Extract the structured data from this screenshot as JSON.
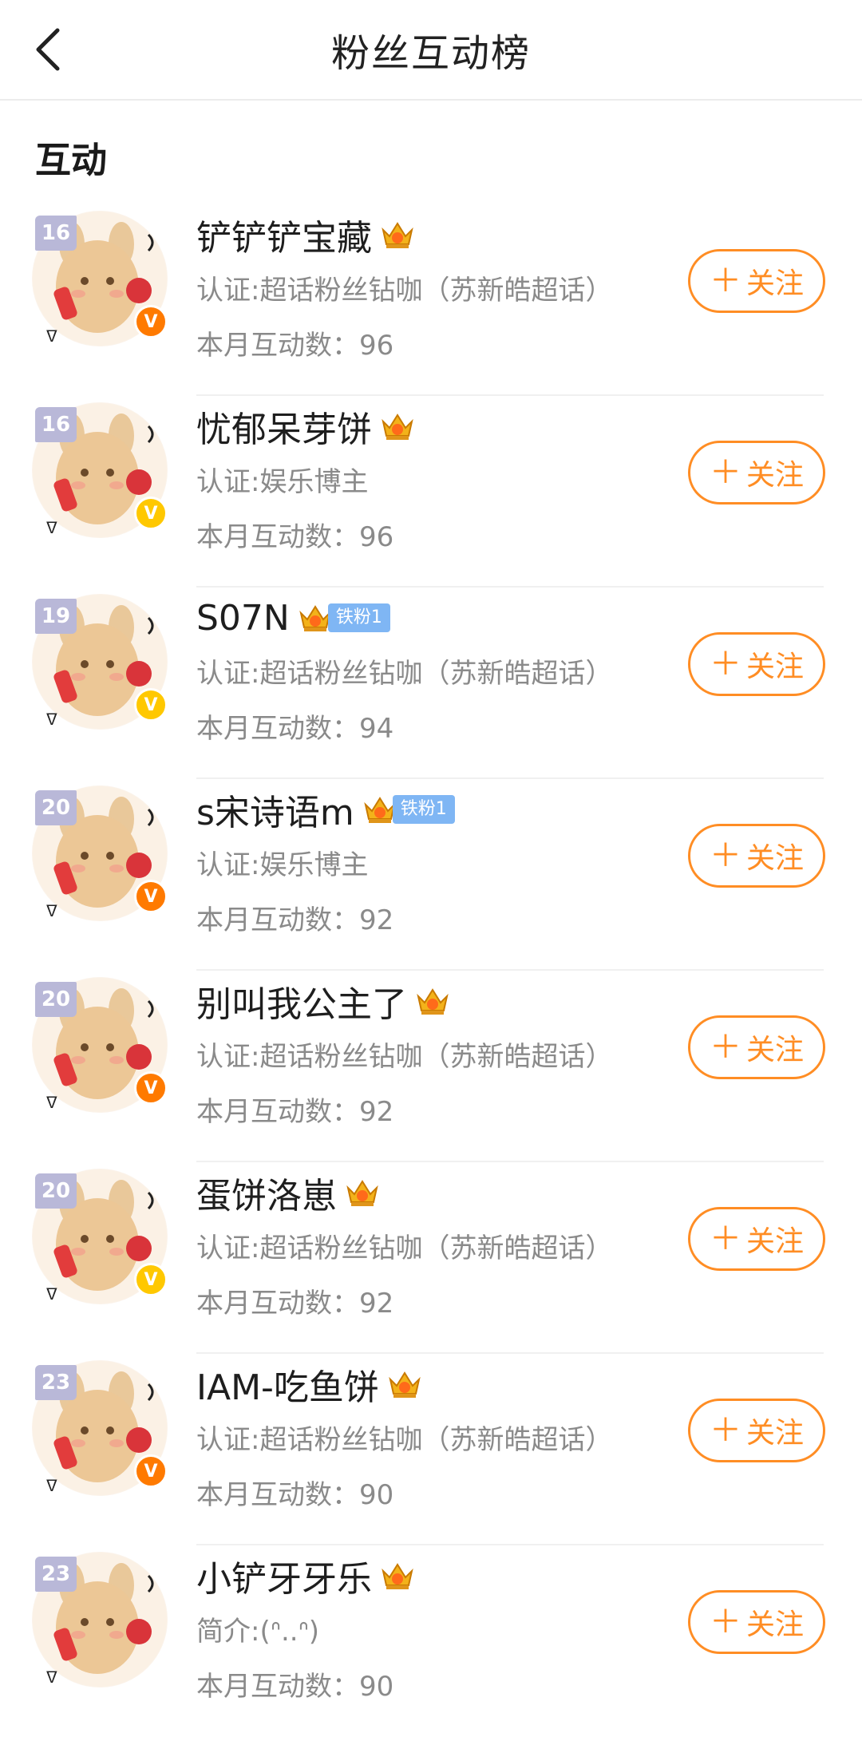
{
  "header": {
    "title": "粉丝互动榜",
    "back_icon": "chevron-left-icon"
  },
  "section": {
    "title": "互动"
  },
  "colors": {
    "accent": "#ff8d24",
    "verified_orange": "#ff7a00",
    "verified_yellow": "#ffc800",
    "tag_blue": "#7fb6f4",
    "rank_badge": "#b9b8d8"
  },
  "users": [
    {
      "rank_level": "16",
      "name": "铲铲铲宝藏",
      "tag": "",
      "verified": "orange",
      "desc": "认证:超话粉丝钻咖（苏新皓超话）",
      "count": "本月互动数：96",
      "follow_label": "关注"
    },
    {
      "rank_level": "16",
      "name": "忧郁呆芽饼",
      "tag": "",
      "verified": "yellow",
      "desc": "认证:娱乐博主",
      "count": "本月互动数：96",
      "follow_label": "关注"
    },
    {
      "rank_level": "19",
      "name": "S07N",
      "tag": "铁粉1",
      "verified": "yellow",
      "desc": "认证:超话粉丝钻咖（苏新皓超话）",
      "count": "本月互动数：94",
      "follow_label": "关注"
    },
    {
      "rank_level": "20",
      "name": "s宋诗语m",
      "tag": "铁粉1",
      "verified": "orange",
      "desc": "认证:娱乐博主",
      "count": "本月互动数：92",
      "follow_label": "关注"
    },
    {
      "rank_level": "20",
      "name": "别叫我公主了",
      "tag": "",
      "verified": "orange",
      "desc": "认证:超话粉丝钻咖（苏新皓超话）",
      "count": "本月互动数：92",
      "follow_label": "关注"
    },
    {
      "rank_level": "20",
      "name": "蛋饼洛崽",
      "tag": "",
      "verified": "yellow",
      "desc": "认证:超话粉丝钻咖（苏新皓超话）",
      "count": "本月互动数：92",
      "follow_label": "关注"
    },
    {
      "rank_level": "23",
      "name": "IAM-吃鱼饼",
      "tag": "",
      "verified": "orange",
      "desc": "认证:超话粉丝钻咖（苏新皓超话）",
      "count": "本月互动数：90",
      "follow_label": "关注"
    },
    {
      "rank_level": "23",
      "name": "小铲牙牙乐",
      "tag": "",
      "verified": "",
      "desc": "简介:(ᐢ..ᐢ)",
      "count": "本月互动数：90",
      "follow_label": "关注"
    }
  ]
}
